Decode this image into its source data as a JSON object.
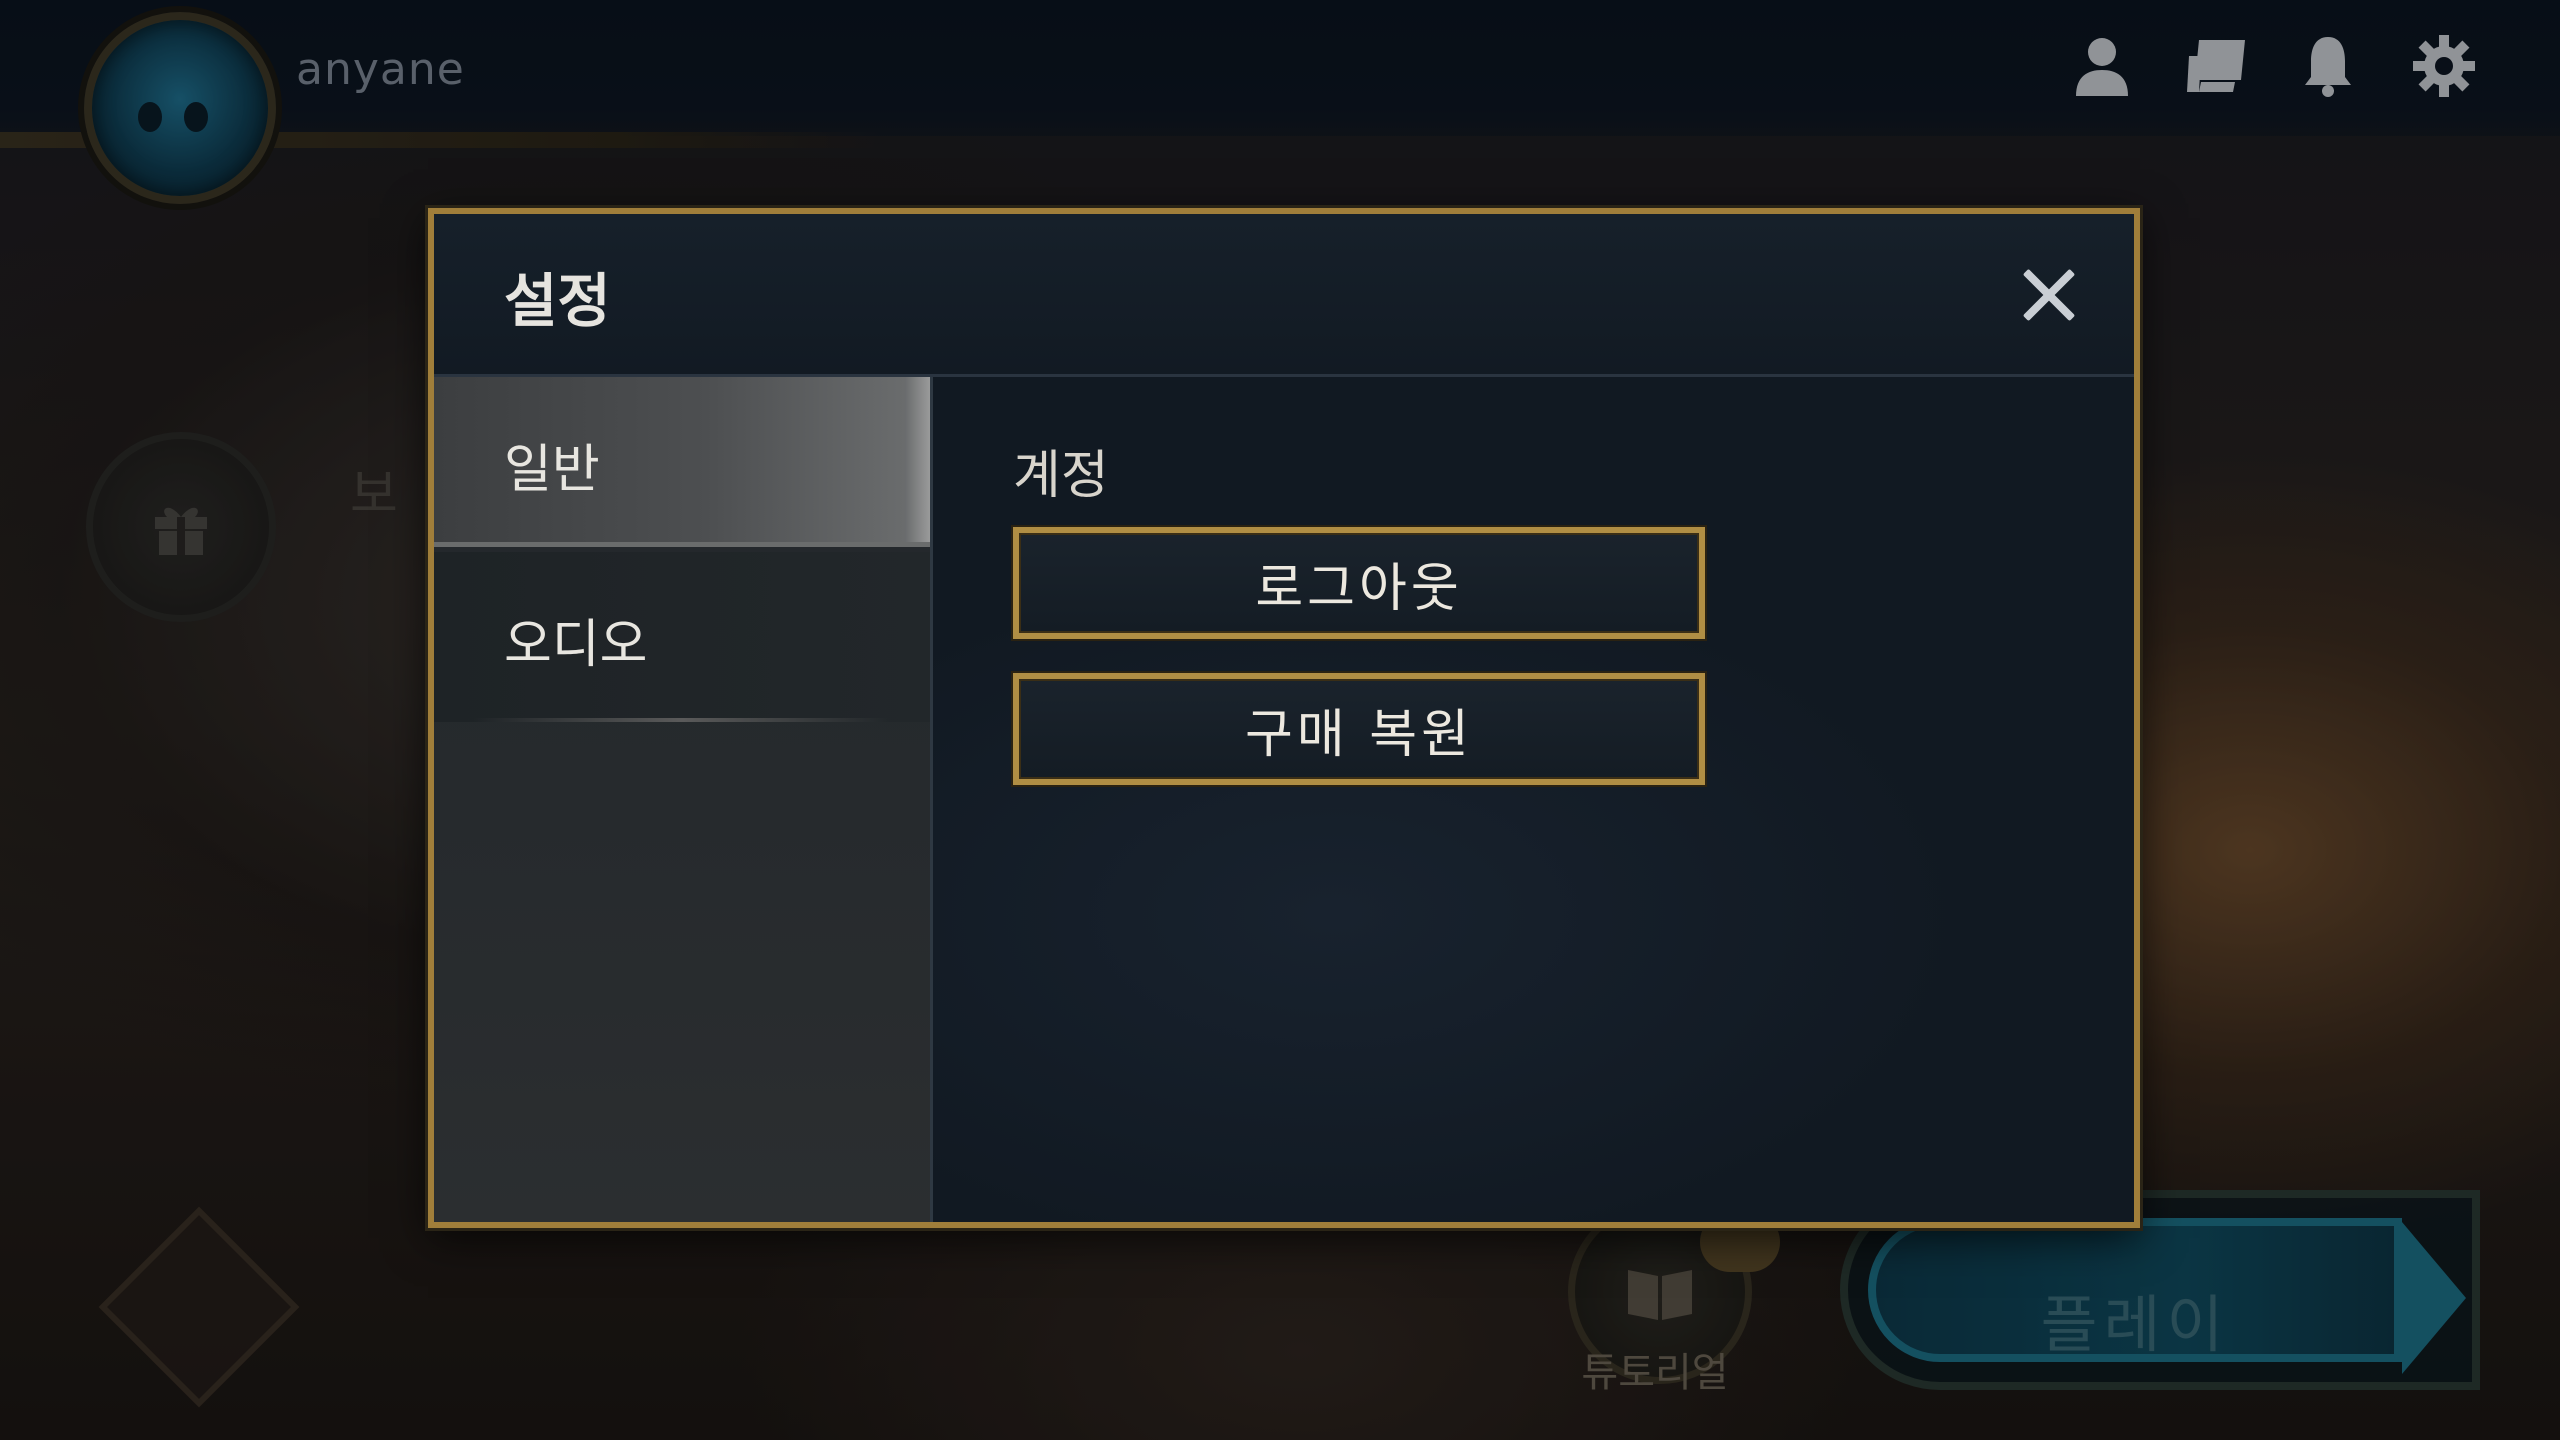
{
  "profile": {
    "username": "anyane"
  },
  "top_icons": [
    "profile-icon",
    "collection-icon",
    "bell-icon",
    "gear-icon"
  ],
  "background": {
    "side_text": "보",
    "tutorial_label": "튜토리얼",
    "play_label": "플레이"
  },
  "settings_modal": {
    "title": "설정",
    "tabs": [
      {
        "label": "일반",
        "active": true
      },
      {
        "label": "오디오",
        "active": false
      }
    ],
    "section_title": "계정",
    "buttons": [
      {
        "label": "로그아웃"
      },
      {
        "label": "구매 복원"
      }
    ]
  },
  "colors": {
    "accent_gold": "#a07e3a",
    "modal_bg": "#131c26",
    "text": "#e8e6e0"
  }
}
